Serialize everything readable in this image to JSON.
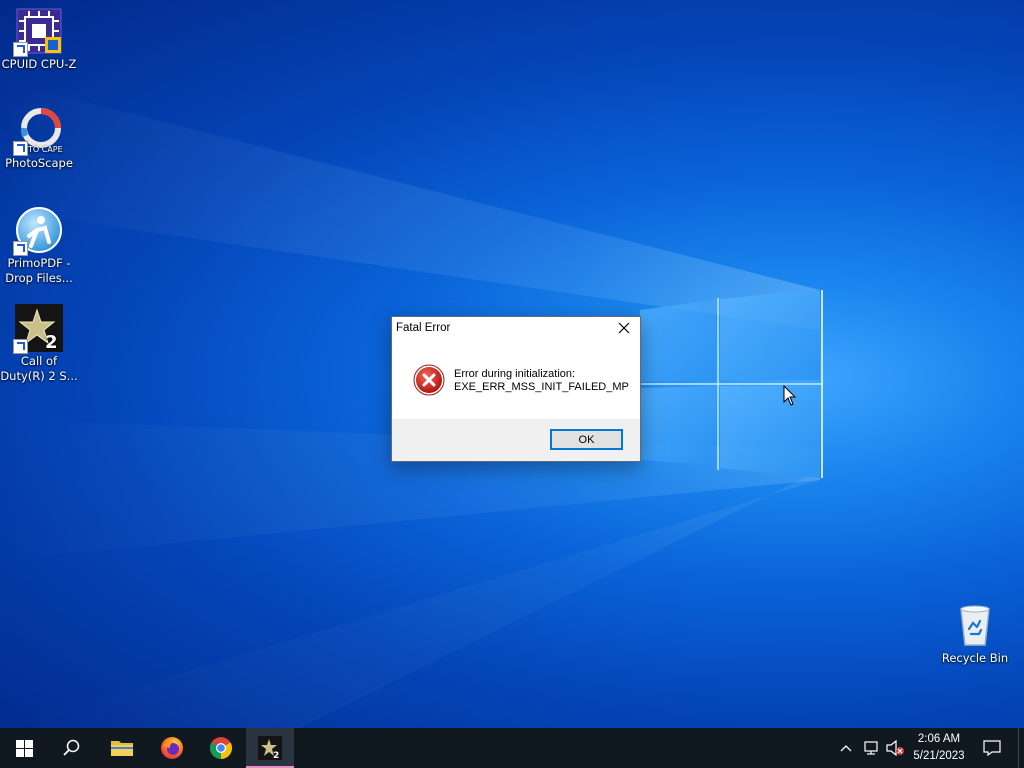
{
  "desktop": {
    "icons": [
      {
        "label": "CPUID CPU-Z",
        "icon": "cpuz-icon"
      },
      {
        "label": "PhotoScape",
        "icon": "photoscape-icon",
        "logo_text": "TO CAPE"
      },
      {
        "label_line1": "PrimoPDF -",
        "label_line2": "Drop Files...",
        "icon": "primopdf-icon"
      },
      {
        "label_line1": "Call of",
        "label_line2": "Duty(R) 2 S...",
        "icon": "cod2-icon",
        "logo_text": "2"
      },
      {
        "label": "Recycle Bin",
        "icon": "recycle-bin-icon"
      }
    ]
  },
  "dialog": {
    "title": "Fatal Error",
    "message_line1": "Error during initialization:",
    "message_line2": "EXE_ERR_MSS_INIT_FAILED_MP",
    "ok_label": "OK",
    "icon": "error-icon"
  },
  "taskbar": {
    "items": [
      {
        "name": "start",
        "icon": "windows-logo-icon"
      },
      {
        "name": "search",
        "icon": "search-icon"
      },
      {
        "name": "file-explorer",
        "icon": "folder-icon"
      },
      {
        "name": "firefox",
        "icon": "firefox-icon"
      },
      {
        "name": "chrome",
        "icon": "chrome-icon"
      },
      {
        "name": "cod2",
        "icon": "cod2-icon",
        "active": true,
        "logo_text": "2"
      }
    ],
    "tray": {
      "time": "2:06 AM",
      "date": "5/21/2023",
      "icons": [
        "chevron-up-icon",
        "network-icon",
        "volume-muted-icon",
        "notification-icon"
      ]
    }
  },
  "colors": {
    "desktop_accent": "#0a63d8",
    "taskbar_bg": "#101820",
    "active_indicator": "#e890c8",
    "button_focus": "#0078d7",
    "error_red": "#c42b1c"
  }
}
